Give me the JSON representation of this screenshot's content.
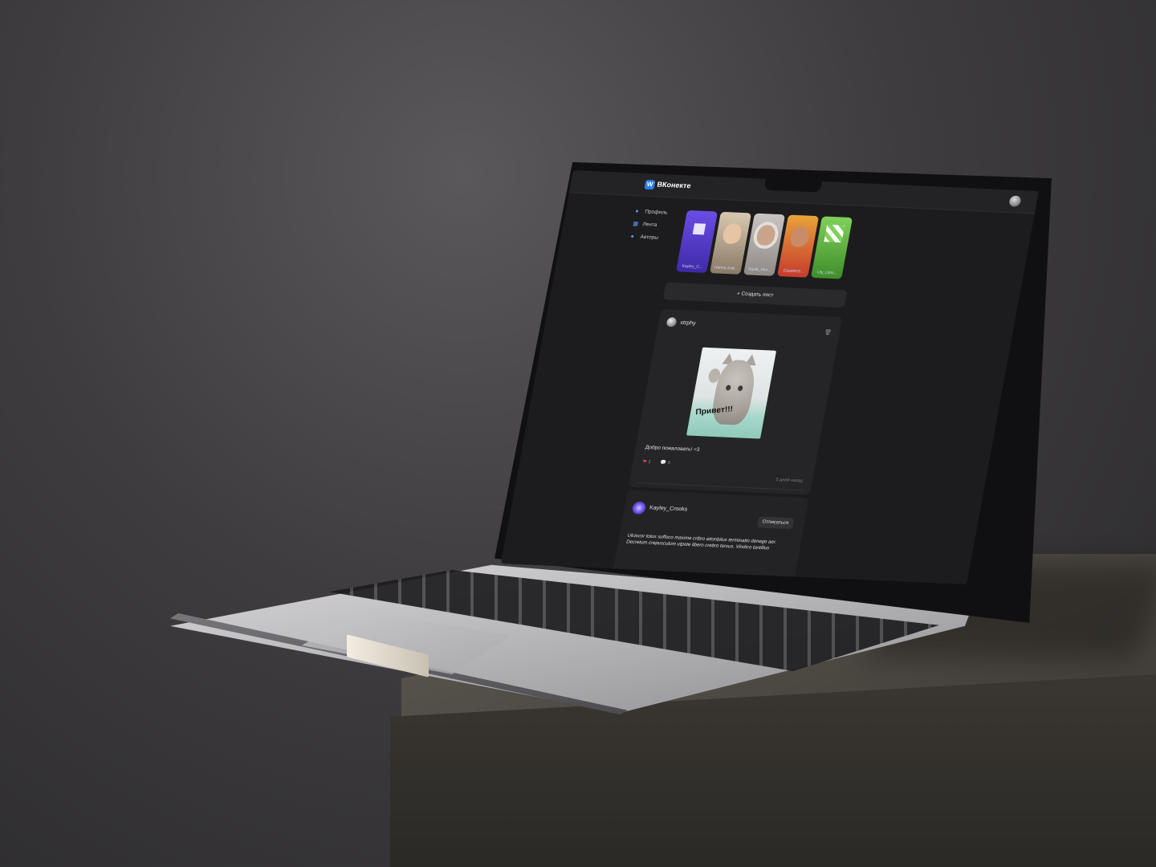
{
  "app": {
    "logo_mark": "W",
    "name": "ВКонекте"
  },
  "sidebar": {
    "items": [
      {
        "label": "Профиль",
        "icon": "user-icon"
      },
      {
        "label": "Лента",
        "icon": "feed-icon"
      },
      {
        "label": "Авторы",
        "icon": "authors-icon"
      }
    ]
  },
  "stories": [
    {
      "label": "Kayley_C..."
    },
    {
      "label": "Hanna And..."
    },
    {
      "label": "Aiyab_Him..."
    },
    {
      "label": "Caselen3..."
    },
    {
      "label": "Lily_Upto..."
    }
  ],
  "composer": {
    "create_label": "Создать пост",
    "plus": "+"
  },
  "post": {
    "author": "xtrphy",
    "image_caption": "Привет!!!",
    "text": "Добро пожаловать! <3",
    "likes": "1",
    "comments": "0",
    "time": "5 дней назад"
  },
  "author_card": {
    "name": "Kayley_Crooks",
    "unsubscribe_label": "Отписаться",
    "bio": "Ulciscor totus suffoco maxime cribro attonbitus terminatio denego aer. Decretum crepusculum utpote libero crebro tersus. Vindico tantillus"
  },
  "colors": {
    "accent": "#2f7de1",
    "like": "#e64646",
    "background": "#1c1c1e"
  }
}
